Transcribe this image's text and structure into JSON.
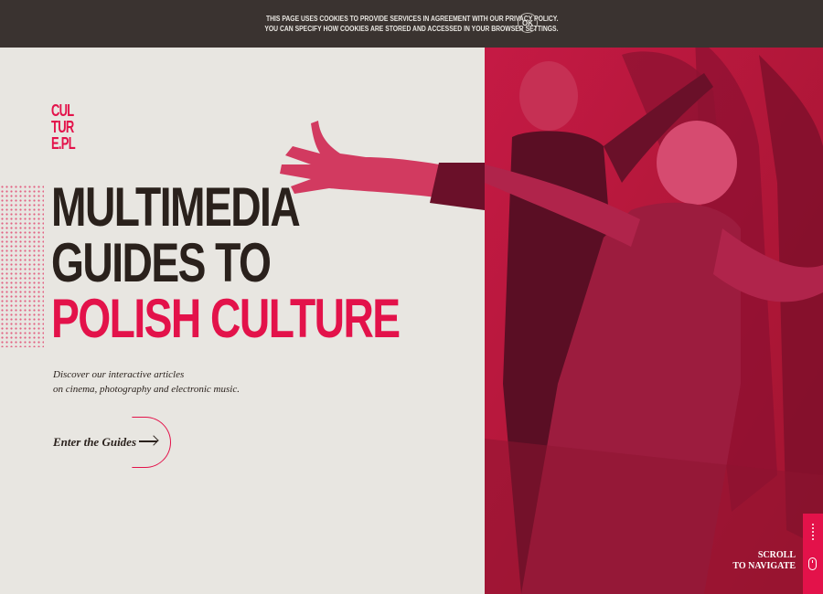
{
  "cookie": {
    "line1": "THIS PAGE USES COOKIES TO PROVIDE SERVICES IN AGREEMENT WITH OUR PRIVACY POLICY.",
    "line2": "YOU CAN SPECIFY HOW COOKIES ARE STORED AND ACCESSED IN YOUR BROWSER SETTINGS.",
    "ok_label": "OK"
  },
  "logo": {
    "lines": [
      "CUL",
      "TUR",
      "E.PL"
    ]
  },
  "hero": {
    "headline_line1": "MULTIMEDIA",
    "headline_line2": "GUIDES TO",
    "headline_line3": "POLISH CULTURE",
    "subtitle_line1": "Discover our interactive articles",
    "subtitle_line2": "on cinema, photography and electronic music.",
    "cta_label": "Enter the Guides"
  },
  "scroll": {
    "line1": "SCROLL",
    "line2": "TO NAVIGATE"
  },
  "colors": {
    "accent": "#e3124a",
    "dark": "#2a211c",
    "background": "#e8e6e1",
    "cookie_bar": "#3a3330"
  },
  "icons": {
    "cta": "arrow-right-icon",
    "cookie_ok": "ok-circle-icon",
    "scroll": "mouse-icon"
  }
}
